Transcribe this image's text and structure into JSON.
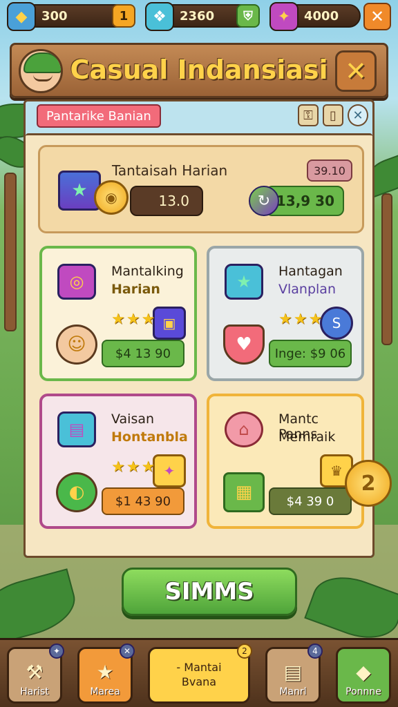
{
  "resources": [
    {
      "icon": "map-icon",
      "value": "300",
      "action": "1",
      "color": "#4aa0d8"
    },
    {
      "icon": "crystal-icon",
      "value": "2360",
      "action": "",
      "color": "#4ac0d8"
    },
    {
      "icon": "gem-icon",
      "value": "4000",
      "action": "",
      "color": "#c04ac0"
    }
  ],
  "header": {
    "title": "Casual Indansiasi"
  },
  "panel": {
    "tab_label": "Pantarike Banian"
  },
  "daily": {
    "name": "Tantaisah Harian",
    "badge": "39.10",
    "amount_coins": "13.0",
    "amount_gems": "13,9 30"
  },
  "items": [
    {
      "name1": "Mantalking",
      "name2": "Harian",
      "name2_color": "#7a5a0c",
      "stars": "★★★",
      "price": "$4 13 90",
      "price_bg": "#6ab84a",
      "price_fg": "#1f3a12"
    },
    {
      "name1": "Hantagan",
      "name2": "Vlanplan",
      "name2_color": "#5a3fa0",
      "stars": "★★★",
      "price": "Inge: $9 06",
      "price_bg": "#6ab84a",
      "price_fg": "#1f3a12"
    },
    {
      "name1": "Vaisan",
      "name2": "Hontanbla",
      "name2_color": "#c07a0c",
      "stars": "★★★",
      "price": "$1 43 90",
      "price_bg": "#f29a3a",
      "price_fg": "#3a2210"
    },
    {
      "name1": "Mantc Panns",
      "name2": "Memraik",
      "name2_color": "#2a1f14",
      "stars": "",
      "price": "$4 39 0",
      "price_bg": "#6a7a3a",
      "price_fg": "#ffffff"
    }
  ],
  "primary_button": "SIMMS",
  "nav": [
    {
      "label": "Harist",
      "badge": ""
    },
    {
      "label": "Marea",
      "badge": ""
    },
    {
      "label": "- Mantai\nBvana",
      "badge": "2"
    },
    {
      "label": "Manrl",
      "badge": "4"
    },
    {
      "label": "Ponnne",
      "badge": ""
    }
  ]
}
